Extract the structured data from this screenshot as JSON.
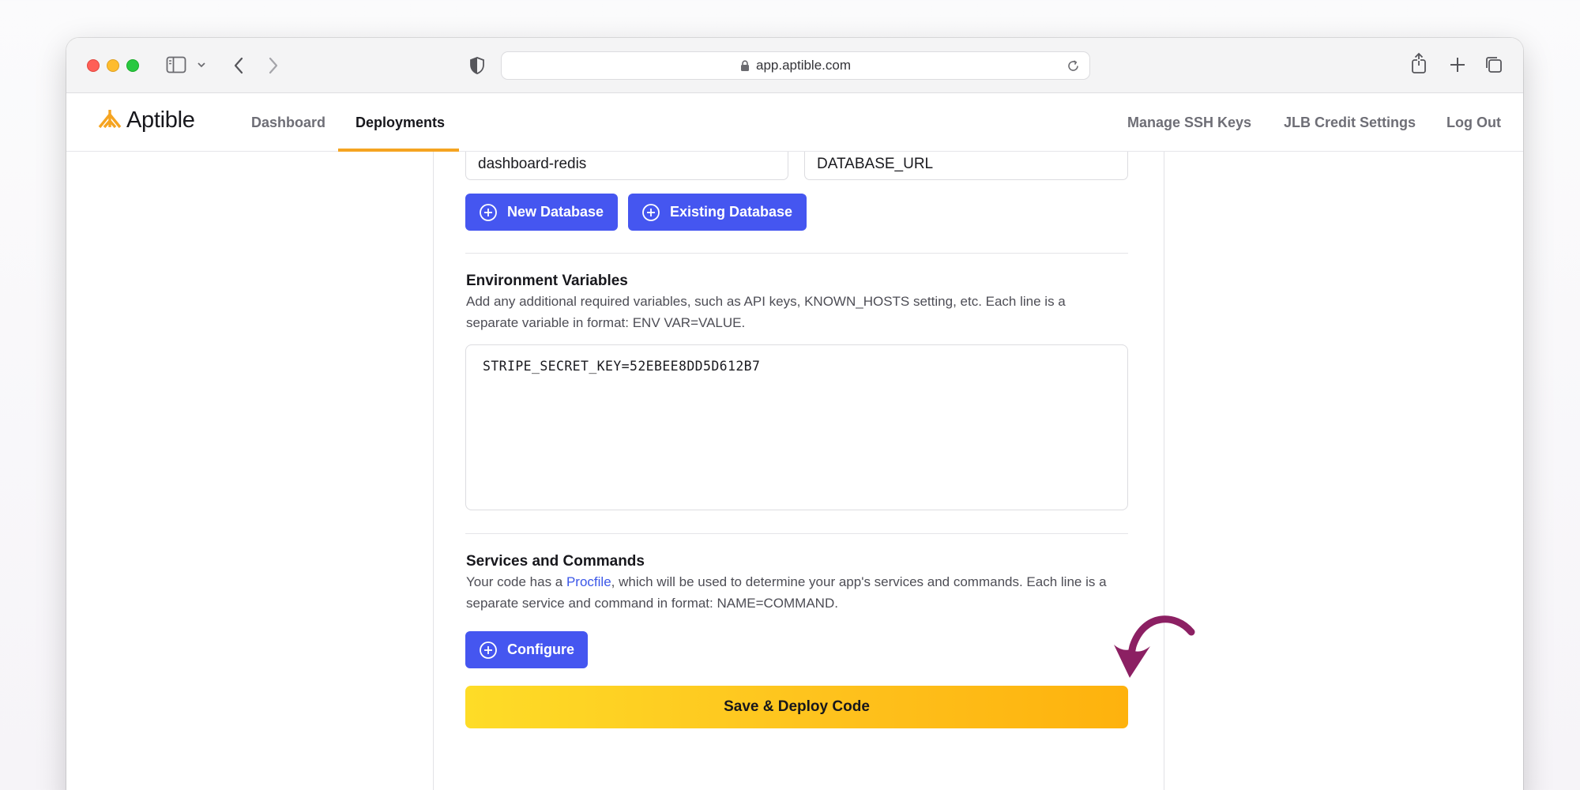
{
  "browser": {
    "url": "app.aptible.com"
  },
  "header": {
    "logo_text": "Aptible",
    "nav": [
      {
        "label": "Dashboard"
      },
      {
        "label": "Deployments"
      }
    ],
    "active_nav": "Deployments",
    "right_links": [
      {
        "label": "Manage SSH Keys"
      },
      {
        "label": "JLB Credit Settings"
      },
      {
        "label": "Log Out"
      }
    ]
  },
  "database": {
    "name_value": "dashboard-redis",
    "env_var_value": "DATABASE_URL",
    "new_button": "New Database",
    "existing_button": "Existing Database"
  },
  "env_vars": {
    "title": "Environment Variables",
    "description": "Add any additional required variables, such as API keys, KNOWN_HOSTS setting, etc. Each line is a separate variable in format: ENV VAR=VALUE.",
    "value": "STRIPE_SECRET_KEY=52EBEE8DD5D612B7"
  },
  "services": {
    "title": "Services and Commands",
    "desc_before": "Your code has a ",
    "desc_link": "Procfile",
    "desc_after": ", which will be used to determine your app's services and commands. Each line is a separate service and command in format: NAME=COMMAND.",
    "configure_button": "Configure"
  },
  "deploy_button": "Save & Deploy Code",
  "colors": {
    "primary_button": "#4556f0",
    "accent": "#f5a421",
    "deploy_gradient_start": "#fedc27",
    "deploy_gradient_end": "#feb20d",
    "annotation_arrow": "#8c2063"
  },
  "icons": {
    "sidebar": "sidebar-icon",
    "back": "chevron-left-icon",
    "forward": "chevron-right-icon",
    "privacy": "shield-icon",
    "lock": "lock-icon",
    "reload": "reload-icon",
    "share": "share-icon",
    "new_tab": "plus-icon",
    "tabs": "tabs-overview-icon",
    "button_plus": "plus-circle-icon",
    "annotation": "curved-arrow-icon"
  }
}
